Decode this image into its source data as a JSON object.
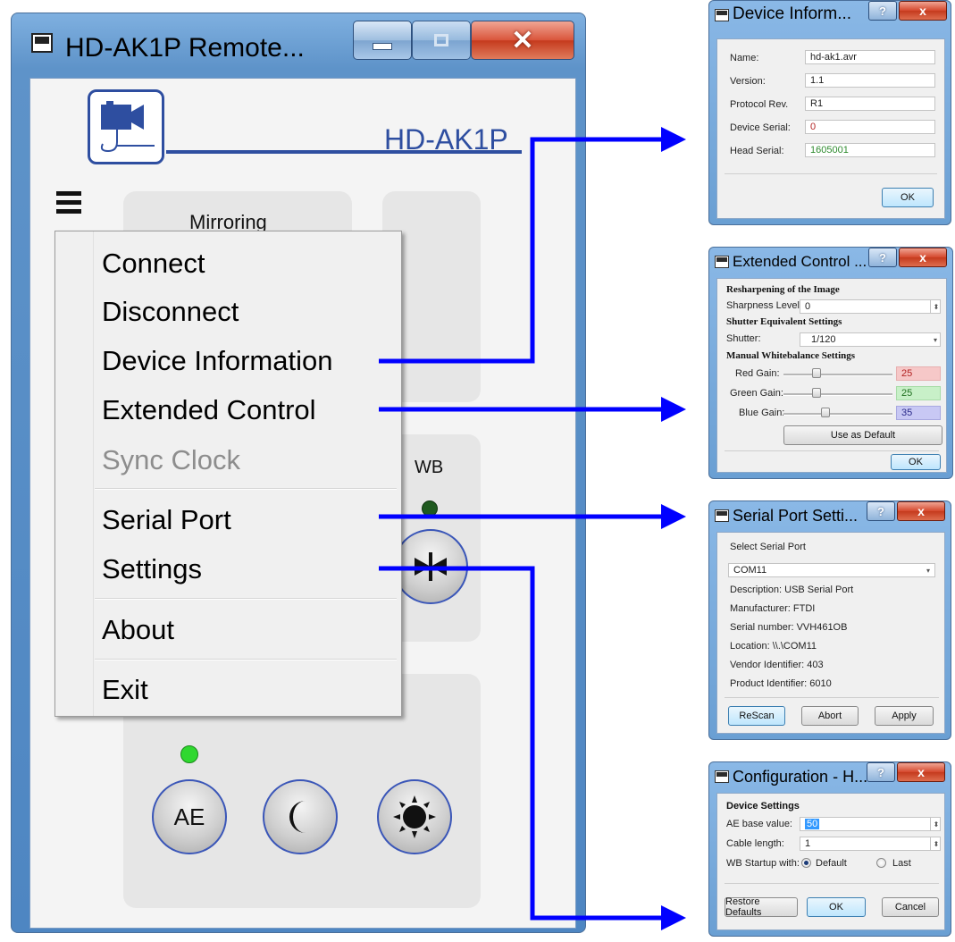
{
  "main_window": {
    "title": "HD-AK1P Remote...",
    "controls": {
      "minimize": "minimize",
      "maximize": "maximize",
      "close": "close"
    },
    "logo_icon": "camera-cable-icon",
    "brand_label": "HD-AK1P",
    "hamburger_icon": "hamburger-menu-icon",
    "mirroring_label": "Mirroring",
    "wb_label": "WB",
    "wb_indicator_color": "#1f5a1f",
    "ae_indicator_color": "#2fd82f",
    "wb_button_icon": "bowtie-icon",
    "buttons": {
      "ae": "AE",
      "night_icon": "crescent-moon-icon",
      "day_icon": "sun-icon"
    }
  },
  "menu": {
    "items": [
      {
        "label": "Connect",
        "enabled": true
      },
      {
        "label": "Disconnect",
        "enabled": true
      },
      {
        "label": "Device Information",
        "enabled": true
      },
      {
        "label": "Extended Control",
        "enabled": true
      },
      {
        "label": "Sync Clock",
        "enabled": false
      },
      {
        "label": "Serial Port",
        "enabled": true
      },
      {
        "label": "Settings",
        "enabled": true
      },
      {
        "label": "About",
        "enabled": true
      },
      {
        "label": "Exit",
        "enabled": true
      }
    ]
  },
  "device_info_dialog": {
    "title": "Device Inform...",
    "help": "?",
    "close": "x",
    "fields": [
      {
        "label": "Name:",
        "value": "hd-ak1.avr"
      },
      {
        "label": "Version:",
        "value": "1.1"
      },
      {
        "label": "Protocol Rev.",
        "value": "R1"
      },
      {
        "label": "Device Serial:",
        "value": "0"
      },
      {
        "label": "Head Serial:",
        "value": "1605001"
      }
    ],
    "device_serial_color": "#b22222",
    "head_serial_color": "#2e8b2e",
    "ok": "OK"
  },
  "extended_control_dialog": {
    "title": "Extended Control ...",
    "help": "?",
    "close": "x",
    "section_resharpen": "Resharpening of the Image",
    "sharpness_label": "Sharpness Level:",
    "sharpness_value": "0",
    "section_shutter": "Shutter Equivalent Settings",
    "shutter_label": "Shutter:",
    "shutter_value": "1/120",
    "section_wb": "Manual Whitebalance Settings",
    "gains": [
      {
        "label": "Red Gain:",
        "value": "25",
        "color": "#f6c8c8"
      },
      {
        "label": "Green Gain:",
        "value": "25",
        "color": "#c8f0c8"
      },
      {
        "label": "Blue Gain:",
        "value": "35",
        "color": "#c8c8f4"
      }
    ],
    "use_default": "Use as Default",
    "ok": "OK"
  },
  "serial_port_dialog": {
    "title": "Serial Port Setti...",
    "help": "?",
    "close": "x",
    "group_label": "Select Serial Port",
    "port": "COM11",
    "details": [
      "Description: USB Serial Port",
      "Manufacturer: FTDI",
      "Serial number: VVH461OB",
      "Location: \\\\.\\COM11",
      "Vendor Identifier: 403",
      "Product Identifier: 6010"
    ],
    "rescan": "ReScan",
    "abort": "Abort",
    "apply": "Apply"
  },
  "configuration_dialog": {
    "title": "Configuration - H...",
    "help": "?",
    "close": "x",
    "section": "Device Settings",
    "ae_label": "AE base value:",
    "ae_value": "50",
    "cable_label": "Cable length:",
    "cable_value": "1",
    "wb_startup_label": "WB Startup with:",
    "radio_default": "Default",
    "radio_last": "Last",
    "restore": "Restore Defaults",
    "ok": "OK",
    "cancel": "Cancel"
  },
  "arrow_color": "#0000ff"
}
